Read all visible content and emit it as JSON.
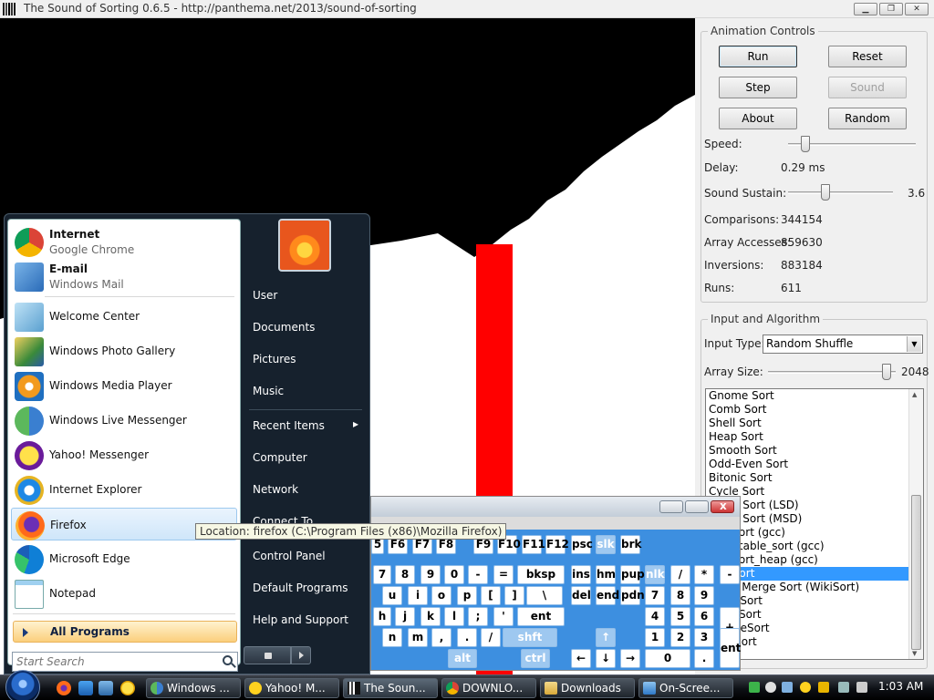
{
  "window": {
    "title": "The Sound of Sorting 0.6.5 - http://panthema.net/2013/sound-of-sorting",
    "minimize": "▁",
    "maximize": "❐",
    "close": "✕"
  },
  "animation_controls": {
    "legend": "Animation Controls",
    "run": "Run",
    "reset": "Reset",
    "step": "Step",
    "sound": "Sound",
    "about": "About",
    "random": "Random",
    "speed_label": "Speed:",
    "delay_label": "Delay:",
    "delay_value": "0.29 ms",
    "sustain_label": "Sound Sustain:",
    "sustain_value": "3.6",
    "comparisons_label": "Comparisons:",
    "comparisons_value": "344154",
    "accesses_label": "Array Accesses:",
    "accesses_value": "859630",
    "inversions_label": "Inversions:",
    "inversions_value": "883184",
    "runs_label": "Runs:",
    "runs_value": "611"
  },
  "input_algorithm": {
    "legend": "Input and Algorithm",
    "input_type_label": "Input Type:",
    "input_type_value": "Random Shuffle",
    "array_size_label": "Array Size:",
    "array_size_value": "2048",
    "algorithms": [
      "Gnome Sort",
      "Comb Sort",
      "Shell Sort",
      "Heap Sort",
      "Smooth Sort",
      "Odd-Even Sort",
      "Bitonic Sort",
      "Cycle Sort",
      "Radix Sort (LSD)",
      "Radix Sort (MSD)",
      "std::sort (gcc)",
      "std::stable_sort (gcc)",
      "std::sort_heap (gcc)",
      "Tim Sort",
      "Block Merge Sort (WikiSort)",
      "Bogo Sort",
      "Bozo Sort",
      "StoogeSort",
      "SlowSort"
    ],
    "selected_index": 13
  },
  "start_menu": {
    "pinned": [
      {
        "name": "Internet",
        "sub": "Google Chrome"
      },
      {
        "name": "E-mail",
        "sub": "Windows Mail"
      }
    ],
    "recent": [
      "Welcome Center",
      "Windows Photo Gallery",
      "Windows Media Player",
      "Windows Live Messenger",
      "Yahoo! Messenger",
      "Internet Explorer",
      "Firefox",
      "Microsoft Edge",
      "Notepad"
    ],
    "all_programs": "All Programs",
    "search_placeholder": "Start Search",
    "right_links": [
      "User",
      "Documents",
      "Pictures",
      "Music",
      "Recent Items",
      "Computer",
      "Network",
      "Connect To",
      "Control Panel",
      "Default Programs",
      "Help and Support"
    ],
    "recent_items_arrow": "▸",
    "tooltip": "Location: firefox (C:\\Program Files (x86)\\Mozilla Firefox)"
  },
  "keyboard": {
    "row1": [
      "5",
      "F6",
      "F7",
      "F8",
      "F9",
      "F10",
      "F11",
      "F12",
      "psc",
      "slk",
      "brk"
    ],
    "row2": [
      "7",
      "8",
      "9",
      "0",
      "-",
      "=",
      "bksp",
      "ins",
      "hm",
      "pup",
      "nlk",
      "/",
      "*",
      "-"
    ],
    "row3": [
      "u",
      "i",
      "o",
      "p",
      "[",
      "]",
      "\\",
      "del",
      "end",
      "pdn",
      "7",
      "8",
      "9"
    ],
    "row4": [
      "h",
      "j",
      "k",
      "l",
      ";",
      "'",
      "ent",
      "4",
      "5",
      "6",
      "+"
    ],
    "row5": [
      "n",
      "m",
      ",",
      ".",
      "/",
      "shft",
      "↑",
      "1",
      "2",
      "3"
    ],
    "row6": [
      "alt",
      "ctrl",
      "←",
      "↓",
      "→",
      "0",
      ".",
      "ent"
    ]
  },
  "taskbar": {
    "tasks": [
      "Windows ...",
      "Yahoo! M...",
      "The Soun...",
      "DOWNLO...",
      "Downloads",
      "On-Scree..."
    ],
    "clock": "1:03 AM"
  },
  "colors": {
    "canvas_bg": "#000000",
    "bars": "#ffffff",
    "highlight_bar": "#ff0000",
    "selection": "#3399ff"
  }
}
